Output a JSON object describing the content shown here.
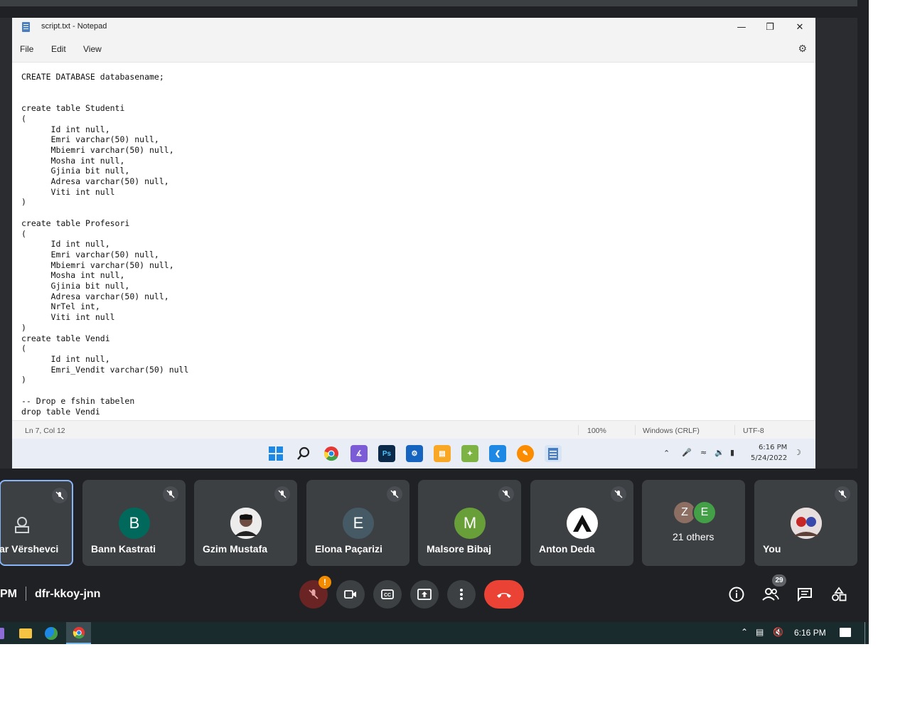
{
  "notepad": {
    "title": "script.txt - Notepad",
    "menu": [
      "File",
      "Edit",
      "View"
    ],
    "content": "CREATE DATABASE databasename;\n\n\ncreate table Studenti\n(\n      Id int null,\n      Emri varchar(50) null,\n      Mbiemri varchar(50) null,\n      Mosha int null,\n      Gjinia bit null,\n      Adresa varchar(50) null,\n      Viti int null\n)\n\ncreate table Profesori\n(\n      Id int null,\n      Emri varchar(50) null,\n      Mbiemri varchar(50) null,\n      Mosha int null,\n      Gjinia bit null,\n      Adresa varchar(50) null,\n      NrTel int,\n      Viti int null\n)\ncreate table Vendi\n(\n      Id int null,\n      Emri_Vendit varchar(50) null\n)\n\n-- Drop e fshin tabelen\ndrop table Vendi",
    "status": {
      "position": "Ln 7, Col 12",
      "zoom": "100%",
      "line_ending": "Windows (CRLF)",
      "encoding": "UTF-8"
    }
  },
  "remote_taskbar": {
    "time": "6:16 PM",
    "date": "5/24/2022"
  },
  "participants": [
    {
      "name": "ar Vërshevci",
      "initial": "",
      "color": "#5f6368"
    },
    {
      "name": "Bann Kastrati",
      "initial": "B",
      "color": "#00695c"
    },
    {
      "name": "Gzim Mustafa",
      "initial": "",
      "color": "#ffffff"
    },
    {
      "name": "Elona Paçarizi",
      "initial": "E",
      "color": "#455a64"
    },
    {
      "name": "Malsore Bibaj",
      "initial": "M",
      "color": "#689f38"
    },
    {
      "name": "Anton Deda",
      "initial": "",
      "color": "#ffffff"
    },
    {
      "name": "21 others",
      "initial": "",
      "color": ""
    },
    {
      "name": "You",
      "initial": "",
      "color": "#c62828"
    }
  ],
  "others_avatars": [
    {
      "initial": "Z",
      "color": "#8d6e63"
    },
    {
      "initial": "E",
      "color": "#43a047"
    }
  ],
  "meeting": {
    "time_fragment": "PM",
    "code": "dfr-kkoy-jnn",
    "people_count": "29",
    "mic_alert": "!"
  },
  "local_taskbar": {
    "time": "6:16 PM"
  },
  "icons": [
    "notepad-icon",
    "minimize-icon",
    "restore-icon",
    "close-icon",
    "settings-icon",
    "start-icon",
    "search-icon",
    "chrome-icon",
    "visual-studio-icon",
    "photoshop-icon",
    "vscode-icon",
    "file-explorer-icon",
    "mic-off-icon",
    "camera-icon",
    "captions-icon",
    "present-icon",
    "more-icon",
    "hangup-icon",
    "info-icon",
    "people-icon",
    "chat-icon",
    "activities-icon",
    "edge-icon"
  ]
}
